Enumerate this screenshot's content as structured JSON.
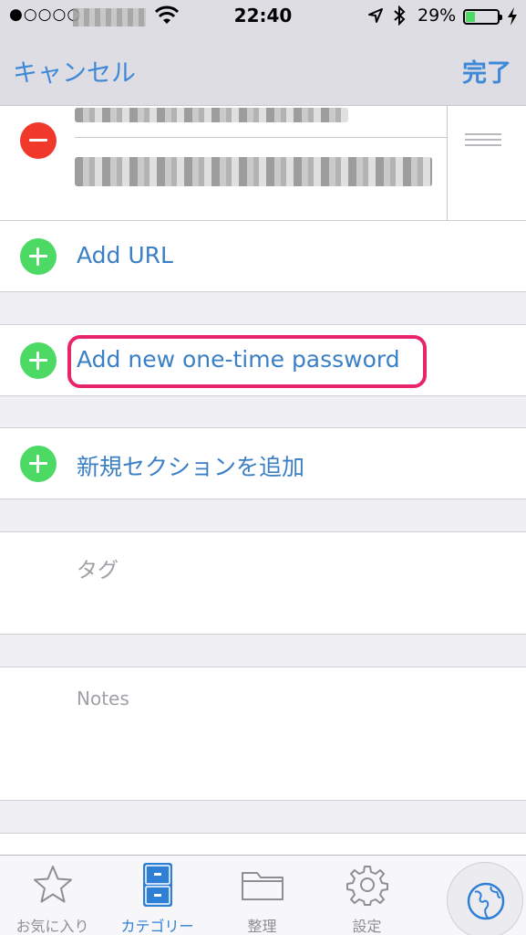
{
  "status_bar": {
    "signal": "●○○○○",
    "time": "22:40",
    "battery_pct": "29%",
    "battery_level": 0.29
  },
  "nav": {
    "cancel_label": "キャンセル",
    "done_label": "完了"
  },
  "rows": {
    "add_url": "Add URL",
    "add_otp": "Add new one-time password",
    "add_section": "新規セクションを追加",
    "tags_label": "タグ",
    "notes_label": "Notes"
  },
  "tabs": [
    {
      "label": "お気に入り",
      "icon": "star-icon"
    },
    {
      "label": "カテゴリー",
      "icon": "file-cabinet-icon"
    },
    {
      "label": "整理",
      "icon": "folder-icon"
    },
    {
      "label": "設定",
      "icon": "gear-icon"
    }
  ],
  "colors": {
    "accent": "#3e88d8",
    "add": "#4cd964",
    "remove": "#f0382b",
    "highlight": "#e8256b"
  }
}
